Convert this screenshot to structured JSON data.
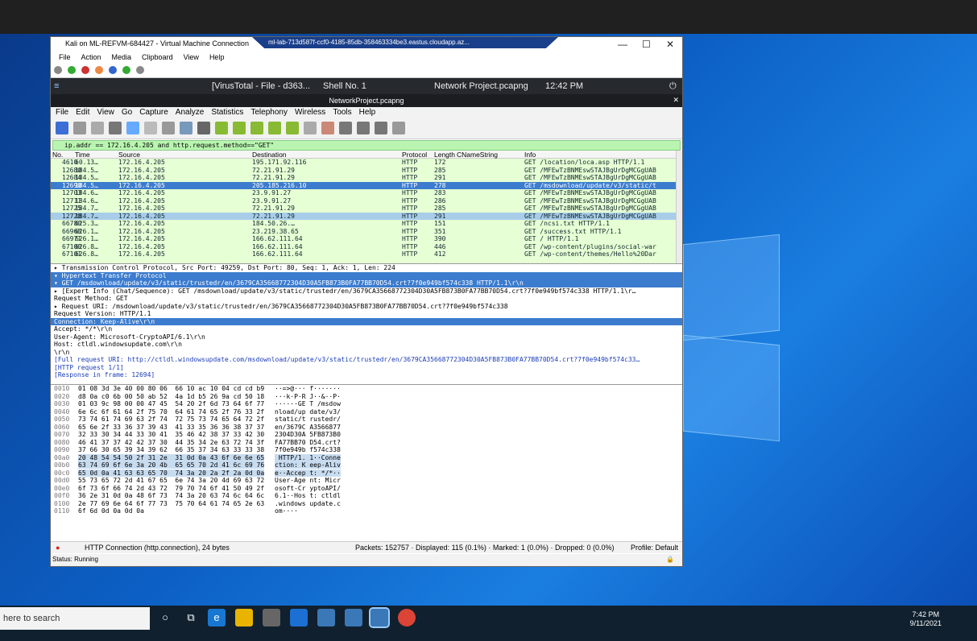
{
  "vm": {
    "title": "Kali on ML-REFVM-684427 - Virtual Machine Connection",
    "rdp_title": "ml-lab-713d587f-ccf0-4185-85db-358463334be3.eastus.cloudapp.az...",
    "menu": [
      "File",
      "Action",
      "Media",
      "Clipboard",
      "View",
      "Help"
    ]
  },
  "kali": {
    "tab1": "[VirusTotal - File - d363...",
    "tab2": "Shell No. 1",
    "tab3": "Network Project.pcapng",
    "clock": "12:42 PM"
  },
  "wireshark": {
    "title": "NetworkProject.pcapng",
    "menu": [
      "File",
      "Edit",
      "View",
      "Go",
      "Capture",
      "Analyze",
      "Statistics",
      "Telephony",
      "Wireless",
      "Tools",
      "Help"
    ],
    "filter": "ip.addr == 172.16.4.205 and http.request.method==\"GET\"",
    "columns": [
      "No.",
      "Time",
      "Source",
      "Destination",
      "Protocol",
      "Length",
      "CNameString",
      "Info"
    ],
    "packets": [
      [
        "4610",
        "60.13…",
        "172.16.4.205",
        "195.171.92.116",
        "HTTP",
        "172",
        "",
        "GET /location/loca.asp HTTP/1.1"
      ],
      [
        "12680",
        "184.5…",
        "172.16.4.205",
        "72.21.91.29",
        "HTTP",
        "285",
        "",
        "GET /MFEwTzBNMEswSTAJBgUrDgMCGgUAB"
      ],
      [
        "12684",
        "184.5…",
        "172.16.4.205",
        "72.21.91.29",
        "HTTP",
        "291",
        "",
        "GET /MFEwTzBNMEswSTAJBgUrDgMCGgUAB"
      ],
      [
        "12690",
        "184.5…",
        "172.16.4.205",
        "205.185.216.10",
        "HTTP",
        "278",
        "",
        "GET /msdownload/update/v3/static/t"
      ],
      [
        "12703",
        "184.6…",
        "172.16.4.205",
        "23.9.91.27",
        "HTTP",
        "283",
        "",
        "GET /MFEwTzBNMEswSTAJBgUrDgMCGgUAB"
      ],
      [
        "12711",
        "184.6…",
        "172.16.4.205",
        "23.9.91.27",
        "HTTP",
        "286",
        "",
        "GET /MFEwTzBNMEswSTAJBgUrDgMCGgUAB"
      ],
      [
        "12725",
        "184.7…",
        "172.16.4.205",
        "72.21.91.29",
        "HTTP",
        "285",
        "",
        "GET /MFEwTzBNMEswSTAJBgUrDgMCGgUAB"
      ],
      [
        "12728",
        "184.7…",
        "172.16.4.205",
        "72.21.91.29",
        "HTTP",
        "291",
        "",
        "GET /MFEwTzBNMEswSTAJBgUrDgMCGgUAB"
      ],
      [
        "66780",
        "625.3…",
        "172.16.4.205",
        "184.50.26.…",
        "HTTP",
        "151",
        "",
        "GET /ncsi.txt HTTP/1.1"
      ],
      [
        "66968",
        "626.1…",
        "172.16.4.205",
        "23.219.38.65",
        "HTTP",
        "351",
        "",
        "GET /success.txt HTTP/1.1"
      ],
      [
        "66971",
        "626.1…",
        "172.16.4.205",
        "166.62.111.64",
        "HTTP",
        "390",
        "",
        "GET / HTTP/1.1"
      ],
      [
        "67100",
        "626.8…",
        "172.16.4.205",
        "166.62.111.64",
        "HTTP",
        "446",
        "",
        "GET /wp-content/plugins/social-war"
      ],
      [
        "67101",
        "626.8…",
        "172.16.4.205",
        "166.62.111.64",
        "HTTP",
        "412",
        "",
        "GET /wp-content/themes/Hello%20Dar"
      ]
    ],
    "details": [
      "▸ Transmission Control Protocol, Src Port: 49259, Dst Port: 80, Seq: 1, Ack: 1, Len: 224",
      "▾ Hypertext Transfer Protocol",
      "   ▾ GET /msdownload/update/v3/static/trustedr/en/3679CA35668772304D30A5FB873B0FA77BB70D54.crt?7f0e949bf574c338 HTTP/1.1\\r\\n",
      "      ▸ [Expert Info (Chat/Sequence): GET /msdownload/update/v3/static/trustedr/en/3679CA35668772304D30A5FB873B0FA77BB70D54.crt?7f0e949bf574c338 HTTP/1.1\\r…",
      "        Request Method: GET",
      "      ▸ Request URI: /msdownload/update/v3/static/trustedr/en/3679CA35668772304D30A5FB873B0FA77BB70D54.crt?7f0e949bf574c338",
      "        Request Version: HTTP/1.1",
      "     Connection: Keep-Alive\\r\\n",
      "     Accept: */*\\r\\n",
      "     User-Agent: Microsoft-CryptoAPI/6.1\\r\\n",
      "     Host: ctldl.windowsupdate.com\\r\\n",
      "     \\r\\n",
      "     [Full request URI: http://ctldl.windowsupdate.com/msdownload/update/v3/static/trustedr/en/3679CA35668772304D30A5FB873B0FA77BB70D54.crt?7f0e949bf574c33…",
      "     [HTTP request 1/1]",
      "     [Response in frame: 12694]"
    ],
    "hex": [
      [
        "0010",
        "01 08 3d 3e 40 00 80 06  66 10 ac 10 04 cd cd b9",
        "··=>@··· f·······"
      ],
      [
        "0020",
        "d8 0a c0 6b 00 50 ab 52  4a 1d b5 26 9a cd 50 18",
        "···k·P·R J··&··P·"
      ],
      [
        "0030",
        "01 03 9c 98 00 00 47 45  54 20 2f 6d 73 64 6f 77",
        "······GE T /msdow"
      ],
      [
        "0040",
        "6e 6c 6f 61 64 2f 75 70  64 61 74 65 2f 76 33 2f",
        "nload/up date/v3/"
      ],
      [
        "0050",
        "73 74 61 74 69 63 2f 74  72 75 73 74 65 64 72 2f",
        "static/t rustedr/"
      ],
      [
        "0060",
        "65 6e 2f 33 36 37 39 43  41 33 35 36 36 38 37 37",
        "en/3679C A3566877"
      ],
      [
        "0070",
        "32 33 30 34 44 33 30 41  35 46 42 38 37 33 42 30",
        "2304D30A 5FB873B0"
      ],
      [
        "0080",
        "46 41 37 37 42 42 37 30  44 35 34 2e 63 72 74 3f",
        "FA77BB70 D54.crt?"
      ],
      [
        "0090",
        "37 66 30 65 39 34 39 62  66 35 37 34 63 33 33 38",
        "7f0e949b f574c338"
      ],
      [
        "00a0",
        "20 48 54 54 50 2f 31 2e  31 0d 0a 43 6f 6e 6e 65",
        " HTTP/1. 1··Conne"
      ],
      [
        "00b0",
        "63 74 69 6f 6e 3a 20 4b  65 65 70 2d 41 6c 69 76",
        "ction: K eep-Aliv"
      ],
      [
        "00c0",
        "65 0d 0a 41 63 63 65 70  74 3a 20 2a 2f 2a 0d 0a",
        "e··Accep t: */*··"
      ],
      [
        "00d0",
        "55 73 65 72 2d 41 67 65  6e 74 3a 20 4d 69 63 72",
        "User-Age nt: Micr"
      ],
      [
        "00e0",
        "6f 73 6f 66 74 2d 43 72  79 70 74 6f 41 50 49 2f",
        "osoft-Cr yptoAPI/"
      ],
      [
        "00f0",
        "36 2e 31 0d 0a 48 6f 73  74 3a 20 63 74 6c 64 6c",
        "6.1··Hos t: ctldl"
      ],
      [
        "0100",
        "2e 77 69 6e 64 6f 77 73  75 70 64 61 74 65 2e 63",
        ".windows update.c"
      ],
      [
        "0110",
        "6f 6d 0d 0a 0d 0a",
        "om····"
      ]
    ],
    "status_field": "HTTP Connection (http.connection), 24 bytes",
    "status_stats": "Packets: 152757 · Displayed: 115 (0.1%) · Marked: 1 (0.0%) · Dropped: 0 (0.0%)",
    "profile": "Profile: Default",
    "status_running": "Status: Running"
  },
  "taskbar": {
    "search": "here to search",
    "time": "7:42 PM",
    "date": "9/11/2021"
  }
}
